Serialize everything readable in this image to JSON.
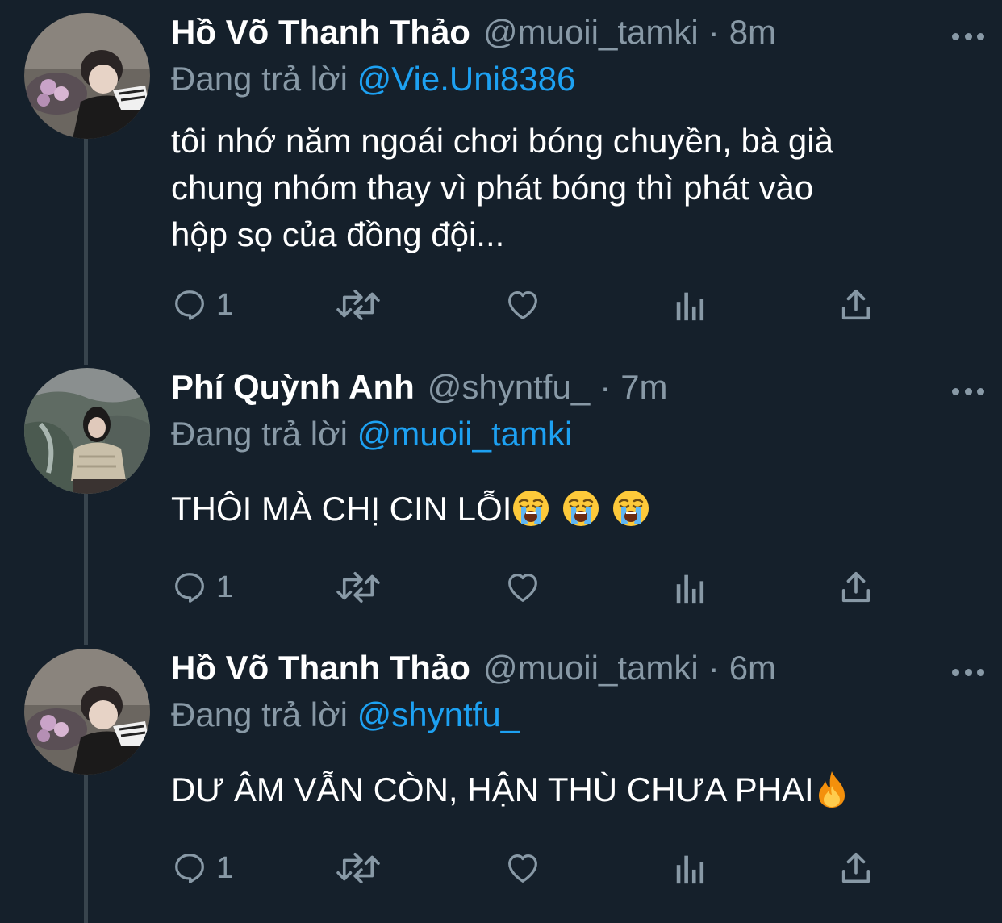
{
  "tweets": [
    {
      "name": "Hồ Võ Thanh Thảo",
      "handle": "@muoii_tamki",
      "separator": "·",
      "time": "8m",
      "replying_prefix": "Đang trả lời",
      "replying_to": "@Vie.Uni8386",
      "body_lines": [
        "tôi nhớ năm ngoái chơi bóng chuyền, bà già",
        "chung nhóm thay vì phát bóng thì phát vào",
        "hộp sọ của đồng đội..."
      ],
      "reply_count": "1",
      "avatar": "woman-with-flowers"
    },
    {
      "name": "Phí Quỳnh Anh",
      "handle": "@shyntfu_",
      "separator": "·",
      "time": "7m",
      "replying_prefix": "Đang trả lời",
      "replying_to": "@muoii_tamki",
      "body_text": "THÔI MÀ CHỊ CIN LỖI",
      "body_emojis": [
        "loudly-crying-face",
        "loudly-crying-face",
        "loudly-crying-face"
      ],
      "reply_count": "1",
      "avatar": "woman-at-mountain"
    },
    {
      "name": "Hồ Võ Thanh Thảo",
      "handle": "@muoii_tamki",
      "separator": "·",
      "time": "6m",
      "replying_prefix": "Đang trả lời",
      "replying_to": "@shyntfu_",
      "body_text": "DƯ ÂM VẪN CÒN, HẬN THÙ CHƯA PHAI",
      "body_emojis": [
        "fire"
      ],
      "reply_count": "1",
      "avatar": "woman-with-flowers"
    }
  ],
  "icons": {
    "reply": "speech-bubble-icon",
    "retweet": "retweet-icon",
    "like": "heart-icon",
    "analytics": "bar-chart-icon",
    "share": "share-upload-icon",
    "more": "ellipsis-icon"
  },
  "colors": {
    "background": "#15202b",
    "text": "#ffffff",
    "secondary": "#8899a6",
    "link": "#1da1f2",
    "thread_line": "#38444d"
  }
}
